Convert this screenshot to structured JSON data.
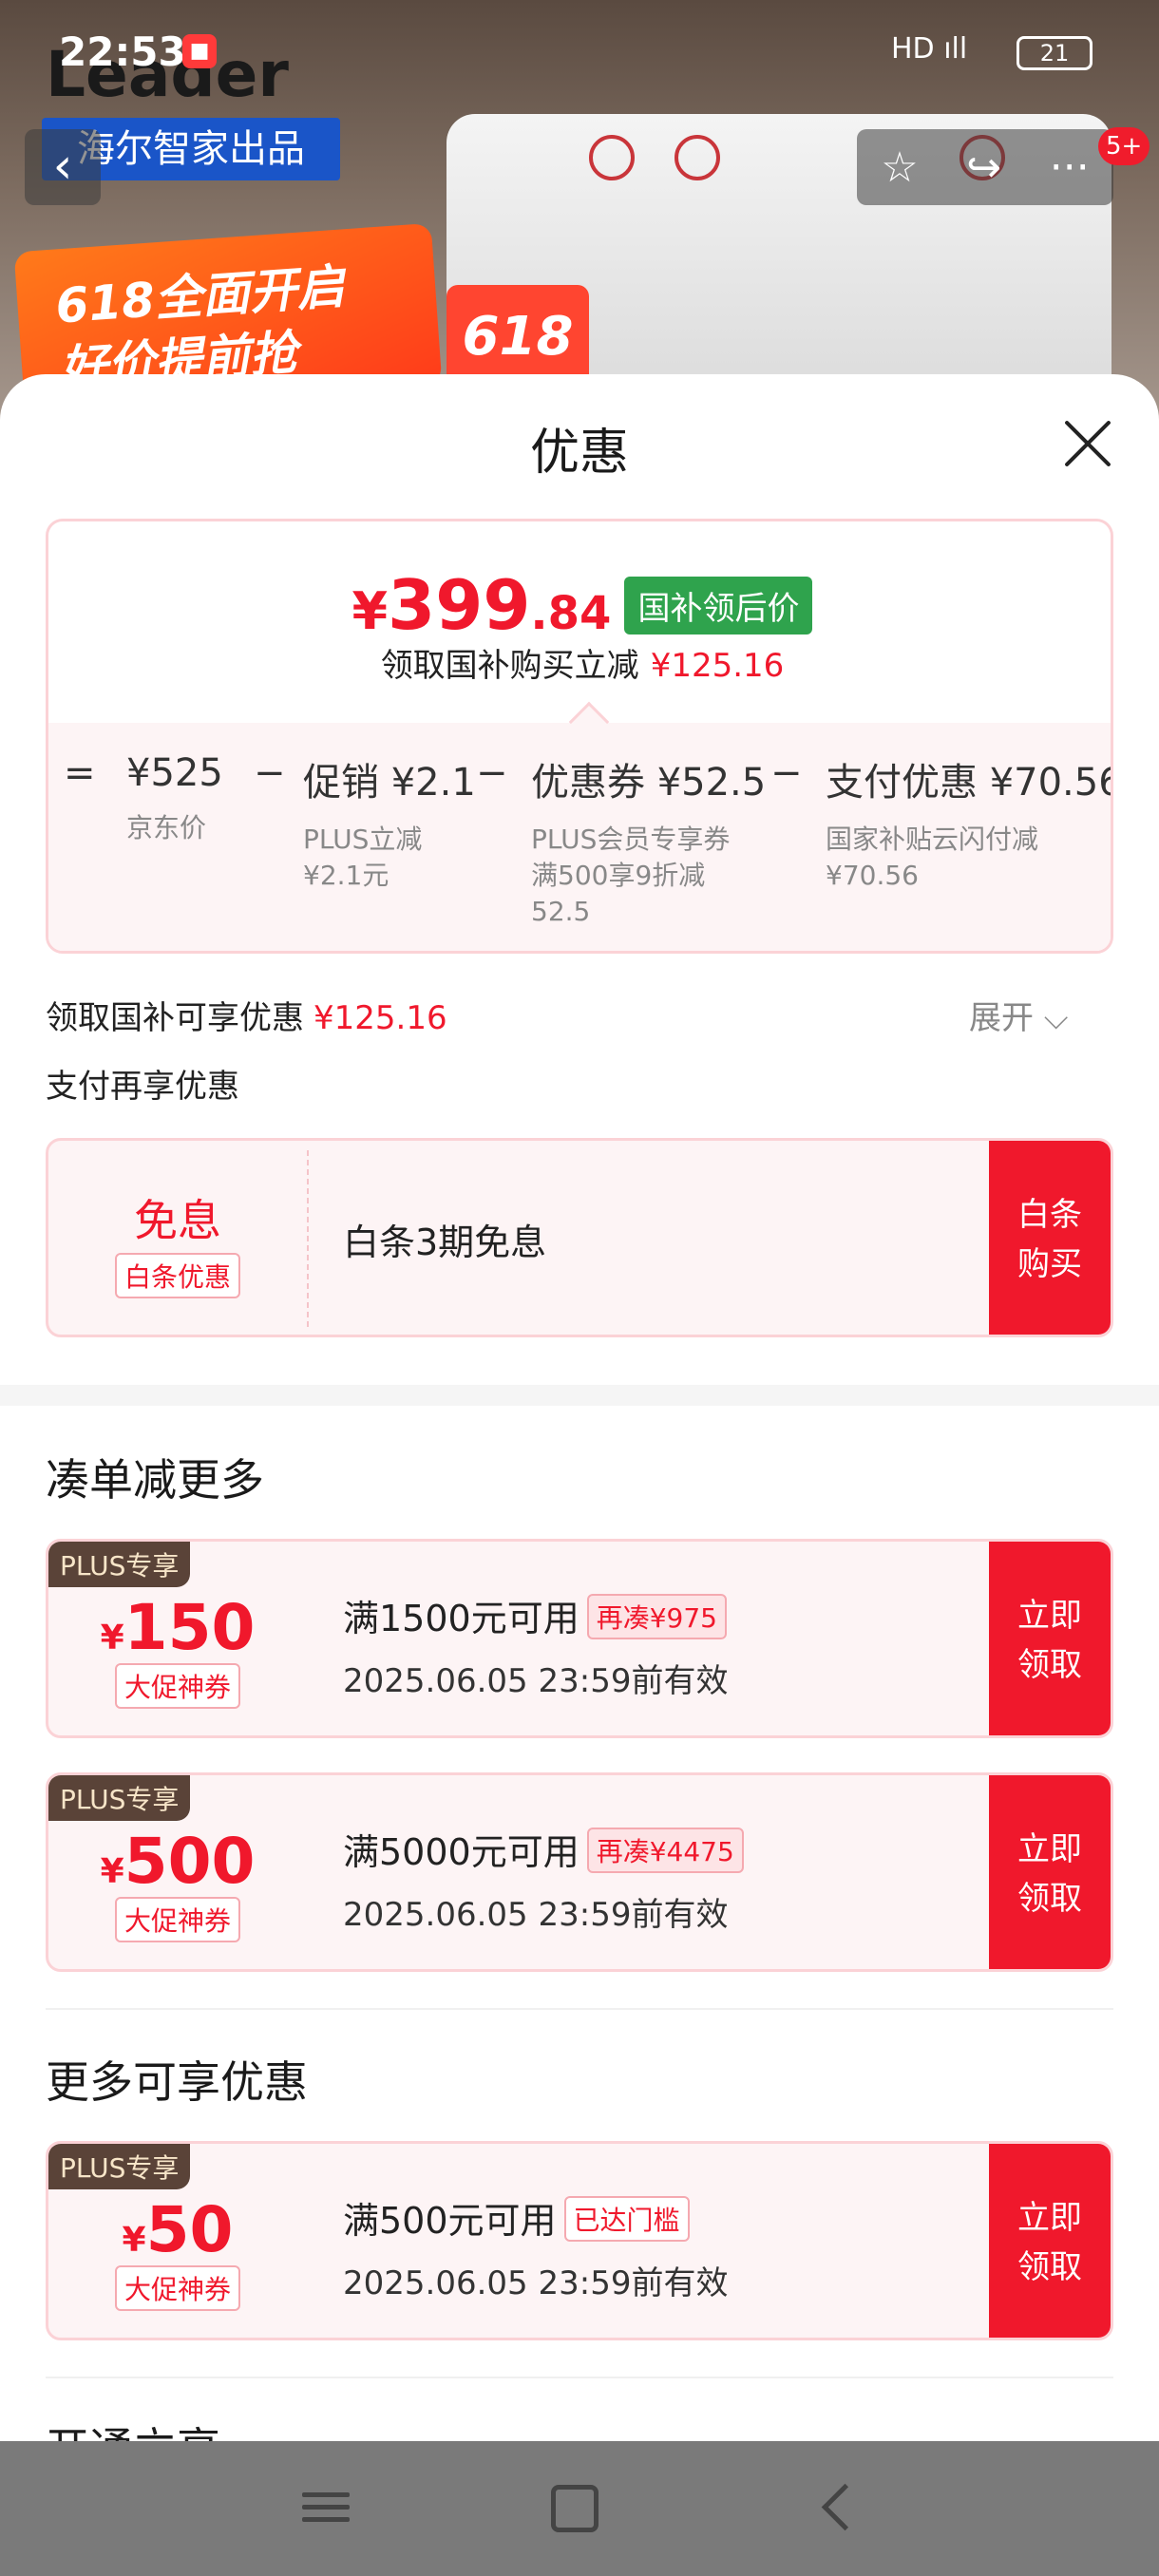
{
  "status_bar": {
    "time": "22:53",
    "signal": "HD ıll ",
    "battery": "21"
  },
  "background": {
    "brand": "Leader",
    "subbrand": "海尔智家出品",
    "promo_line1": "618全面开启",
    "promo_line2": "好价提前抢",
    "tag": "618"
  },
  "nav": {
    "back": "‹",
    "favorite": "☆",
    "share": "↪",
    "more": "···",
    "badge": "5+"
  },
  "sheet": {
    "title": "优惠",
    "price": {
      "currency": "¥",
      "integer": "399",
      "decimal": ".84",
      "tag": "国补领后价",
      "sub_label": "领取国补购买立减",
      "sub_amount": "¥125.16"
    },
    "breakdown": [
      {
        "head": "¥525",
        "desc": "京东价"
      },
      {
        "head": "促销 ¥2.1",
        "desc": "PLUS立减\n¥2.1元"
      },
      {
        "head": "优惠券 ¥52.5",
        "desc": "PLUS会员专享券\n满500享9折减\n52.5"
      },
      {
        "head": "支付优惠 ¥70.56",
        "desc": "国家补贴云闪付减\n¥70.56"
      }
    ],
    "ops": {
      "eq": "=",
      "minus": "−"
    },
    "subsidy_label": "领取国补可享优惠",
    "subsidy_amount": "¥125.16",
    "expand_label": "展开 ⌵",
    "pay_more_label": "支付再享优惠",
    "baitiao": {
      "title": "免息",
      "tag": "白条优惠",
      "desc": "白条3期免息",
      "button": "白条\n购买"
    },
    "section_bundle": "凑单减更多",
    "bundle_coupons": [
      {
        "plus": "PLUS专享",
        "yen": "¥",
        "value": "150",
        "tag": "大促神券",
        "cond": "满1500元可用",
        "extra": "再凑¥975",
        "expiry": "2025.06.05 23:59前有效",
        "button": "立即\n领取"
      },
      {
        "plus": "PLUS专享",
        "yen": "¥",
        "value": "500",
        "tag": "大促神券",
        "cond": "满5000元可用",
        "extra": "再凑¥4475",
        "expiry": "2025.06.05 23:59前有效",
        "button": "立即\n领取"
      }
    ],
    "section_more": "更多可享优惠",
    "more_coupons": [
      {
        "plus": "PLUS专享",
        "yen": "¥",
        "value": "50",
        "tag": "大促神券",
        "cond": "满500元可用",
        "extra": "已达门槛",
        "expiry": "2025.06.05 23:59前有效",
        "button": "立即\n领取"
      }
    ],
    "section_next": "开通立享"
  }
}
